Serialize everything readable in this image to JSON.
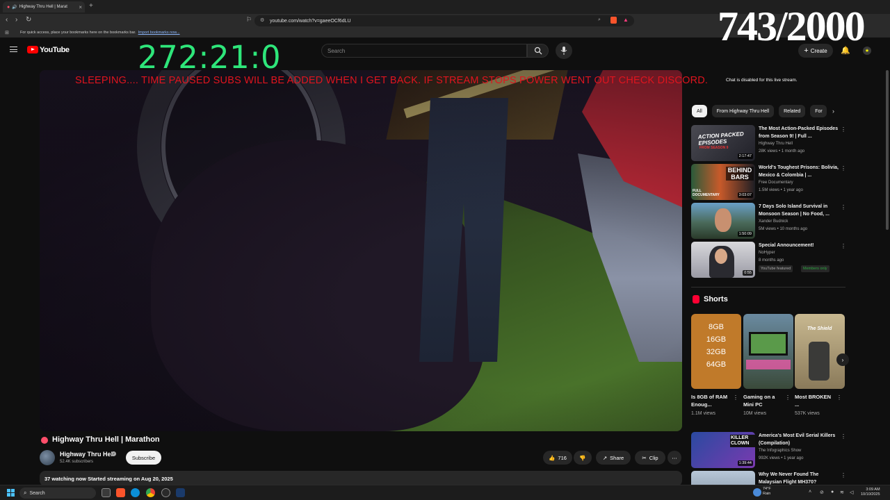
{
  "browser": {
    "tab_title": "Highway Thru Hell | Marat",
    "url": "youtube.com/watch?v=gaeeOCf6dLU",
    "bookmarks_hint": "For quick access, place your bookmarks here on the bookmarks bar.",
    "bookmarks_link": "Import bookmarks now..."
  },
  "youtube": {
    "logo_text": "YouTube",
    "search_placeholder": "Search",
    "create_label": "Create"
  },
  "overlay": {
    "timer": "272:21:0",
    "counter": "743/2000",
    "banner": "SLEEPING.... TIME PAUSED SUBS WILL BE ADDED WHEN I GET BACK. IF STREAM STOPS POWER WENT OUT CHECK DISCORD."
  },
  "video": {
    "title": "Highway Thru Hell | Marathon",
    "channel": "Highway Thru Hell",
    "subscribers": "52.4K subscribers",
    "subscribe_label": "Subscribe",
    "likes": "716",
    "share_label": "Share",
    "clip_label": "Clip",
    "stats": "37 watching now  Started streaming on Aug 20, 2025"
  },
  "sidebar": {
    "chat_disabled": "Chat is disabled for this live stream.",
    "chips": [
      "All",
      "From Highway Thru Hell",
      "Related",
      "For"
    ],
    "recommendations": [
      {
        "title": "The Most Action-Packed Episodes from Season 9! | Full ...",
        "channel": "Highway Thru Hell",
        "meta": "28K views • 1 month ago",
        "duration": "2:17:47",
        "thumb_text": "ACTION PACKED EPISODES",
        "thumb_sub": "FROM SEASON 9"
      },
      {
        "title": "World's Toughest Prisons: Bolivia, Mexico & Colombia | ...",
        "channel": "Free Documentary",
        "meta": "1.5M views • 1 year ago",
        "duration": "3:03:07",
        "thumb_text": "BEHIND BARS",
        "thumb_sub": "FULL DOCUMENTARY"
      },
      {
        "title": "7 Days Solo Island Survival in Monsoon Season | No Food, ...",
        "channel": "Xander Budnick",
        "meta": "5M views • 10 months ago",
        "duration": "1:50:09"
      },
      {
        "title": "Special Announcement!",
        "channel": "NoHyper",
        "meta": "8 months ago",
        "duration": "0:55",
        "badge1": "YouTube featured",
        "badge2": "Members only"
      }
    ],
    "shorts_label": "Shorts",
    "shorts": [
      {
        "title": "Is 8GB of RAM Enoug...",
        "views": "1.1M views",
        "lines": [
          "8GB",
          "16GB",
          "32GB",
          "64GB"
        ]
      },
      {
        "title": "Gaming on a Mini PC",
        "views": "10M views"
      },
      {
        "title": "Most BROKEN ...",
        "views": "537K views",
        "thumb_text": "The Shield"
      }
    ],
    "more_recs": [
      {
        "title": "America's Most Evil Serial Killers (Compilation)",
        "channel": "The Infographics Show",
        "meta": "992K views • 1 year ago",
        "duration": "1:39:44",
        "thumb_text": "KILLER CLOWN"
      },
      {
        "title": "Why We Never Found The Malaysian Flight MH370?"
      }
    ]
  },
  "taskbar": {
    "search": "Search",
    "weather_temp": "74°F",
    "weather_desc": "Rain",
    "time": "3:09 AM",
    "date": "10/10/2025"
  }
}
